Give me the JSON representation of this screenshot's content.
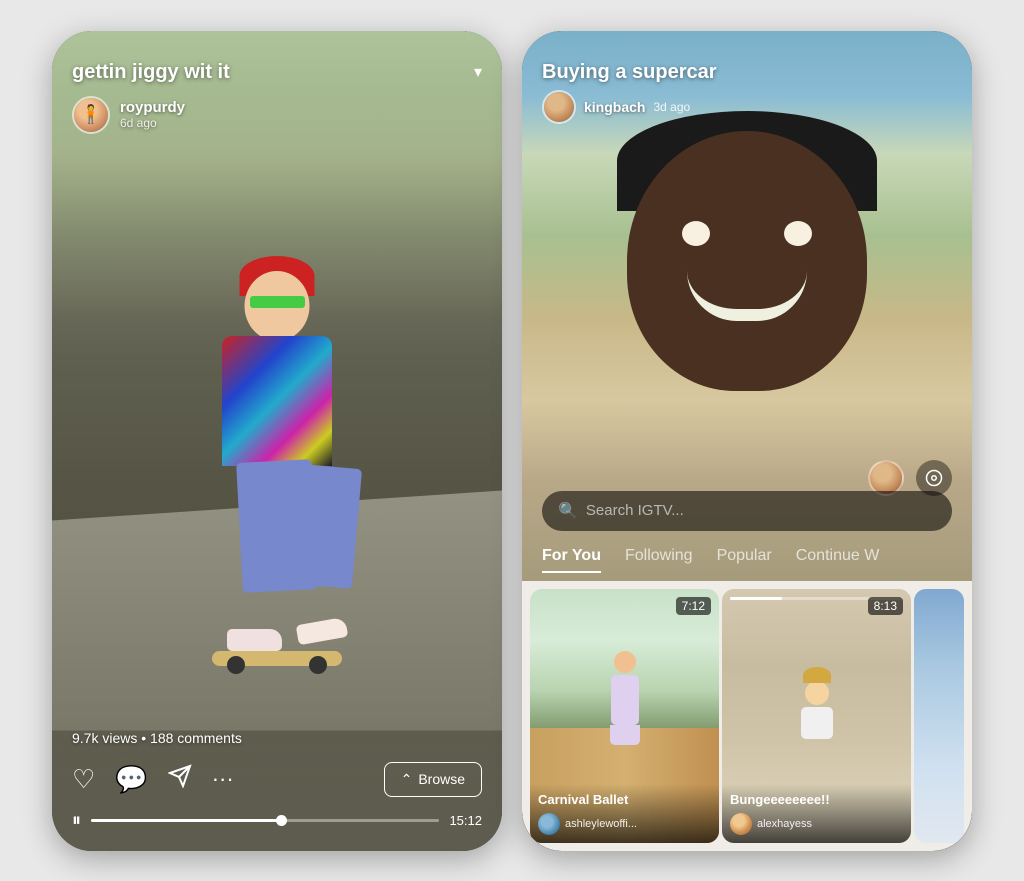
{
  "left_phone": {
    "title": "gettin jiggy wit it",
    "dropdown_symbol": "▾",
    "username": "roypurdy",
    "time_ago": "6d ago",
    "stats": "9.7k views  •  188 comments",
    "browse_label": "Browse",
    "browse_icon": "⌃",
    "duration": "15:12",
    "progress_percent": 55
  },
  "right_phone": {
    "video_title": "Buying a supercar",
    "username": "kingbach",
    "time_ago": "3d ago",
    "search_placeholder": "Search IGTV...",
    "tabs": [
      {
        "label": "For You",
        "active": true
      },
      {
        "label": "Following",
        "active": false
      },
      {
        "label": "Popular",
        "active": false
      },
      {
        "label": "Continue W",
        "active": false
      }
    ],
    "thumbnails": [
      {
        "title": "Carnival Ballet",
        "username": "ashleylewoffi...",
        "duration": "7:12",
        "has_progress": false
      },
      {
        "title": "Bungeeeeeeee!!",
        "username": "alexhayess",
        "duration": "8:13",
        "has_progress": true
      }
    ]
  }
}
